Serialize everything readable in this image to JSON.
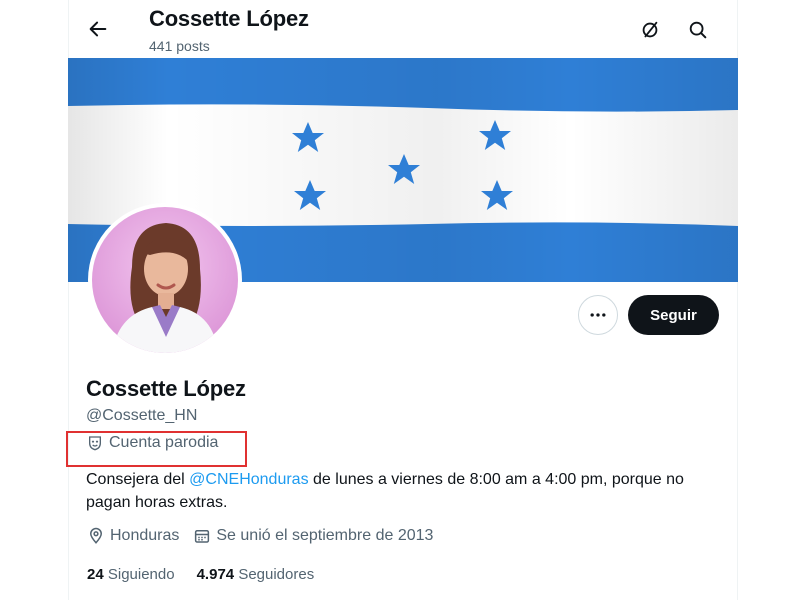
{
  "header": {
    "title": "Cossette López",
    "posts": "441 posts"
  },
  "icons": {
    "back": "arrow-left-icon",
    "subscribe": "slashed-circle-icon",
    "search": "search-icon",
    "more": "more-horizontal-icon",
    "parody": "mask-icon",
    "location": "location-pin-icon",
    "calendar": "calendar-icon"
  },
  "actions": {
    "follow_label": "Seguir"
  },
  "profile": {
    "name": "Cossette López",
    "handle": "@Cossette_HN",
    "parody_label": "Cuenta parodia",
    "bio_prefix": "Consejera del ",
    "bio_mention": "@CNEHonduras",
    "bio_suffix": " de lunes a viernes de 8:00 am a 4:00 pm, porque no pagan horas extras.",
    "location": "Honduras",
    "joined": "Se unió el septiembre de 2013"
  },
  "stats": {
    "following_count": "24",
    "following_label": "Siguiendo",
    "followers_count": "4.974",
    "followers_label": "Seguidores"
  },
  "colors": {
    "flag_blue": "#2f7fd6",
    "highlight_box": "#e03131",
    "link": "#1d9bf0",
    "avatar_bg": "#e8a8e0"
  }
}
